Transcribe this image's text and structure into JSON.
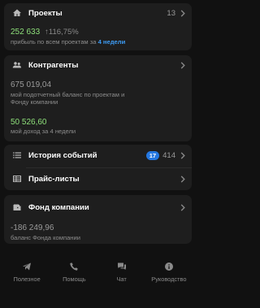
{
  "projects": {
    "title": "Проекты",
    "count": "13",
    "profit": "252 633",
    "growth": "↑116,75%",
    "caption": "прибыль по всем проектам за ",
    "period": "4 недели"
  },
  "counterparties": {
    "title": "Контрагенты",
    "balance_value": "675 019,04",
    "balance_caption_1": "мой подотчетный баланс по проектам и",
    "balance_caption_2": "Фонду компании",
    "income_value": "50 526,60",
    "income_caption": "мой доход за 4 недели"
  },
  "history": {
    "title": "История событий",
    "badge": "17",
    "count": "414"
  },
  "pricelists": {
    "title": "Прайс-листы"
  },
  "fund": {
    "title": "Фонд компании",
    "balance_value": "-186 249,96",
    "balance_caption": "баланс Фонда компании"
  },
  "tabs": [
    {
      "label": "Полезное",
      "icon": "send-icon"
    },
    {
      "label": "Помощь",
      "icon": "phone-icon"
    },
    {
      "label": "Чат",
      "icon": "chat-icon"
    },
    {
      "label": "Руководство",
      "icon": "info-icon"
    }
  ],
  "colors": {
    "background": "#111111",
    "card": "#1e1e1e",
    "positive": "#8ee07a",
    "accent": "#3d9cf5",
    "badge": "#2477e0"
  }
}
